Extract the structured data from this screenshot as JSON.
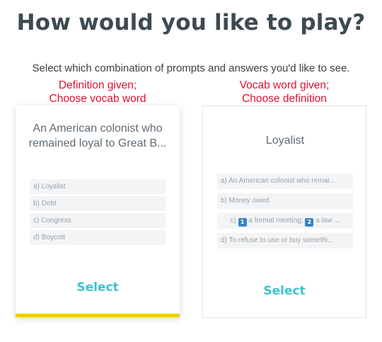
{
  "header": {
    "title": "How would you like to play?",
    "subtitle": "Select which combination of prompts and answers you'd like to see."
  },
  "annotations": {
    "left": [
      "Definition given;",
      "Choose vocab word"
    ],
    "right": [
      "Vocab word given;",
      "Choose definition"
    ],
    "color": "#e0102e"
  },
  "modes": [
    {
      "prompt": "An American colonist who remained loyal to Great B...",
      "options": [
        "a) Loyalist",
        "b) Debt",
        "c) Congress",
        "d) Boycott"
      ],
      "select_label": "Select",
      "selected": true
    },
    {
      "prompt": "Loyalist",
      "options": [
        "a) An American colonist who remai...",
        "b) Money owed",
        {
          "prefix": "c)",
          "parts": [
            {
              "icon": "1",
              "text": "a formal meeting;"
            },
            {
              "icon": "2",
              "text": "a law ..."
            }
          ]
        },
        "d) To refuse to use or buy somethi..."
      ],
      "select_label": "Select",
      "selected": false
    }
  ],
  "colors": {
    "title": "#3d4a52",
    "accent": "#3cc4cf",
    "selected_border": "#f0cb0c",
    "number_badge": "#3b82c4"
  },
  "icons": {
    "number_badge_1": "keycap-1-icon",
    "number_badge_2": "keycap-2-icon"
  }
}
